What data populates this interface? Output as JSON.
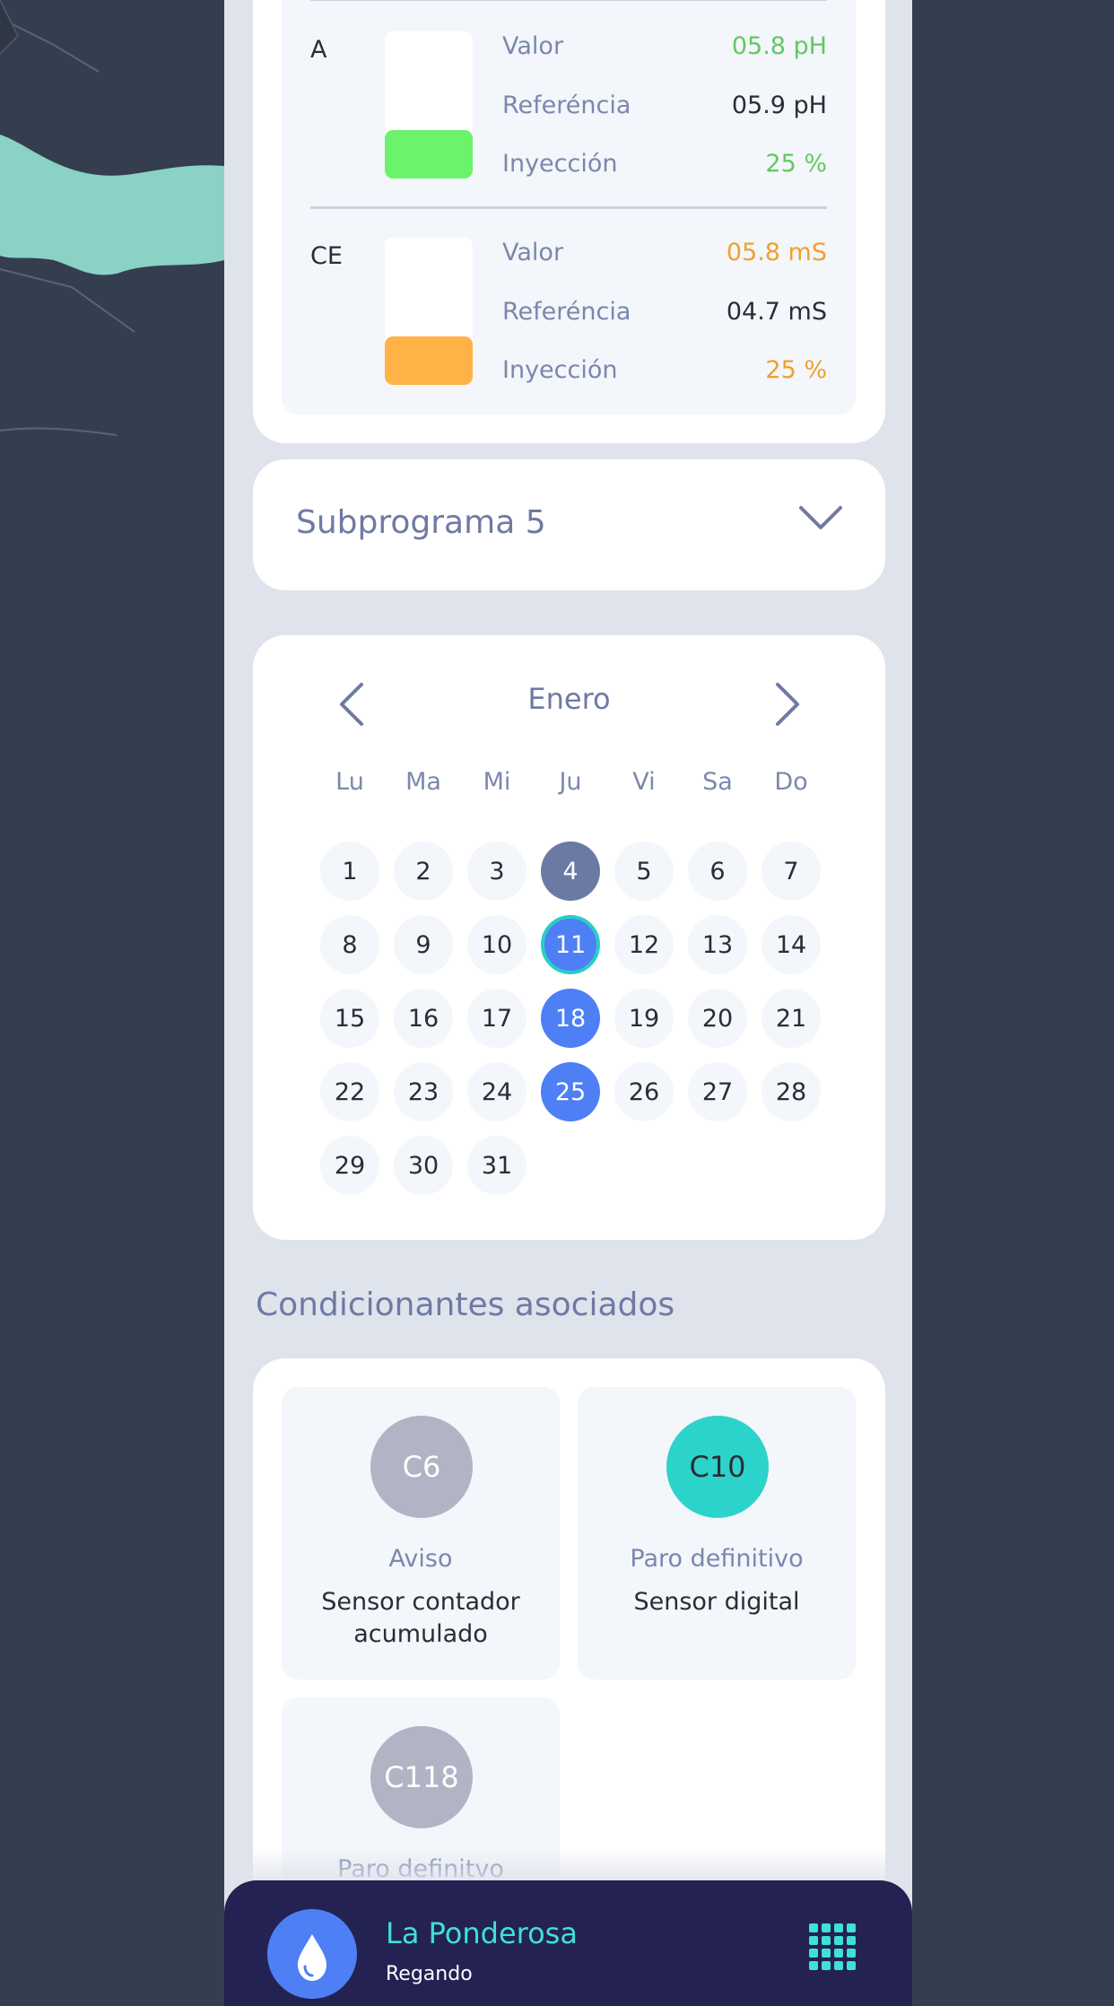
{
  "nutrients": [
    {
      "name": "A",
      "valor_label": "Valor",
      "valor": "05.8 pH",
      "ref_label": "Referéncia",
      "referencia": "05.9 pH",
      "iny_label": "Inyección",
      "inyeccion": "25 %",
      "color": "#6cf36c",
      "level": 0.33
    },
    {
      "name": "CE",
      "valor_label": "Valor",
      "valor": "05.8 mS",
      "ref_label": "Referéncia",
      "referencia": "04.7 mS",
      "iny_label": "Inyección",
      "inyeccion": "25 %",
      "color": "#ffb347",
      "level": 0.33
    }
  ],
  "nutrient_value_colors": {
    "A": "#63c863",
    "CE": "#f0a030"
  },
  "subprograma": {
    "label": "Subprograma 5"
  },
  "calendar": {
    "month": "Enero",
    "weekdays": [
      "Lu",
      "Ma",
      "Mi",
      "Ju",
      "Vi",
      "Sa",
      "Do"
    ],
    "days": [
      "1",
      "2",
      "3",
      "4",
      "5",
      "6",
      "7",
      "8",
      "9",
      "10",
      "11",
      "12",
      "13",
      "14",
      "15",
      "16",
      "17",
      "18",
      "19",
      "20",
      "21",
      "22",
      "23",
      "24",
      "25",
      "26",
      "27",
      "28",
      "29",
      "30",
      "31"
    ],
    "today": "4",
    "selected": [
      "11",
      "18",
      "25"
    ],
    "focused": "11"
  },
  "conditions_title": "Condicionantes asociados",
  "conditions": [
    {
      "code": "C6",
      "type": "Aviso",
      "desc": "Sensor contador acumulado",
      "color": "#b0b4c4",
      "text_color": "#ffffff"
    },
    {
      "code": "C10",
      "type": "Paro definitivo",
      "desc": "Sensor digital",
      "color": "#2cd3cb",
      "text_color": "#2c2c36"
    },
    {
      "code": "C118",
      "type": "Paro definitvo",
      "desc": "",
      "color": "#b0b4c4",
      "text_color": "#ffffff"
    }
  ],
  "bottom_bar": {
    "farm": "La Ponderosa",
    "status": "Regando"
  }
}
